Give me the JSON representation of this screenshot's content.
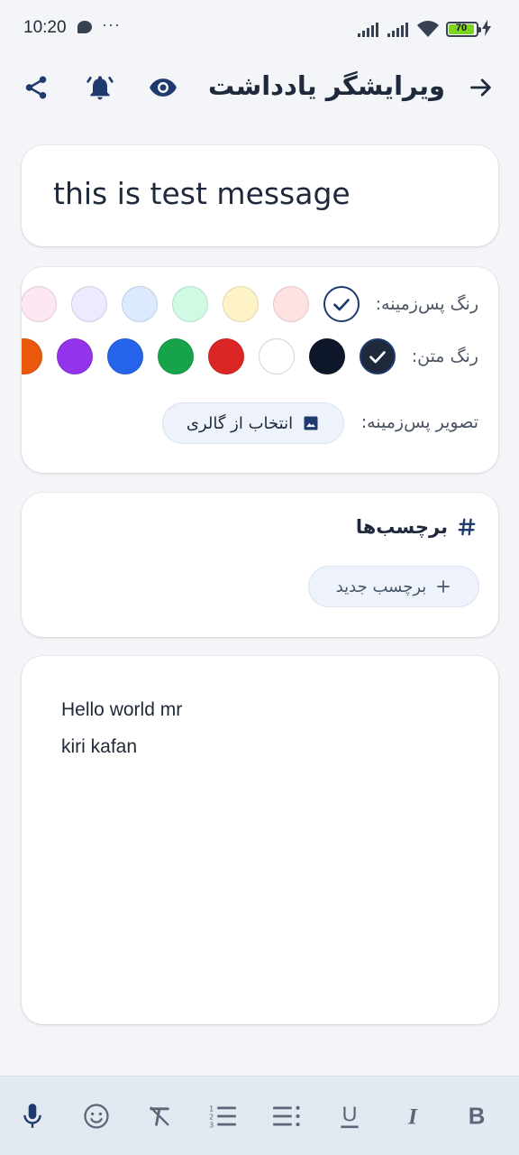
{
  "status_bar": {
    "time": "10:20",
    "overflow": "···",
    "battery": "70",
    "icons": [
      "chat-bubble-icon",
      "signal-icon",
      "signal-icon",
      "wifi-icon",
      "battery-icon",
      "charging-icon"
    ]
  },
  "app_bar": {
    "title": "ویرایشگر یادداشت",
    "icons": [
      "arrow-right-icon",
      "eye-icon",
      "bell-icon",
      "share-icon"
    ]
  },
  "note": {
    "title": "this is test message",
    "body_lines": [
      "Hello world mr",
      "kiri kafan"
    ]
  },
  "appearance": {
    "background_label": "رنگ پس‌زمینه:",
    "text_label": "رنگ متن:",
    "background_image_label": "تصویر پس‌زمینه:",
    "gallery_button": "انتخاب از گالری",
    "background_colors": [
      "#ffffff",
      "#fee2e2",
      "#fef3c7",
      "#d1fae5",
      "#dbeafe",
      "#ede9fe",
      "#fce7f3"
    ],
    "background_selected_index": 0,
    "text_colors": [
      "#1e293b",
      "#0f172a",
      "#ffffff",
      "#dc2626",
      "#16a34a",
      "#2563eb",
      "#9333ea",
      "#ea580c"
    ],
    "text_selected_index": 0
  },
  "tags": {
    "header": "برچسب‌ها",
    "new_tag_button": "برچسب جدید"
  },
  "toolbar": {
    "bold": "B",
    "italic": "I",
    "underline": "U",
    "items": [
      "bold-icon",
      "italic-icon",
      "underline-icon",
      "bullet-list-icon",
      "numbered-list-icon",
      "clear-format-icon",
      "emoji-icon",
      "microphone-icon"
    ]
  },
  "colors": {
    "primary": "#1e3a6e",
    "surface": "#ffffff",
    "background": "#f3f5f8",
    "chip": "#eef3fb"
  }
}
